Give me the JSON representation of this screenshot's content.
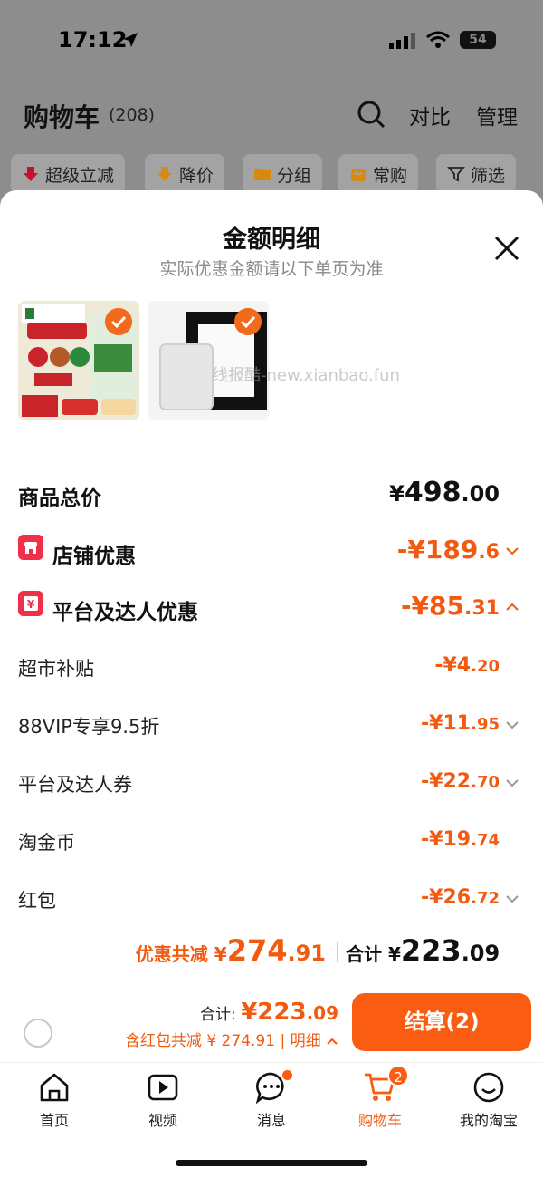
{
  "status": {
    "time": "17:12",
    "battery": "54"
  },
  "cart": {
    "title": "购物车",
    "count": "(208)",
    "compare": "对比",
    "manage": "管理",
    "chips": [
      "超级立减",
      "降价",
      "分组",
      "常购",
      "筛选"
    ]
  },
  "sheet": {
    "title": "金额明细",
    "subtitle": "实际优惠金额请以下单页为准",
    "watermark": "线报酷-new.xianbao.fun",
    "rows": {
      "total_label": "商品总价",
      "total_symbol": "¥",
      "total_int": "498",
      "total_dec": ".00",
      "shop_label": "店铺优惠",
      "shop_int": "-¥189",
      "shop_dec": ".6",
      "platform_label": "平台及达人优惠",
      "platform_int": "-¥85",
      "platform_dec": ".31",
      "sub1_label": "超市补贴",
      "sub1_int": "-¥4",
      "sub1_dec": ".20",
      "sub2_label": "88VIP专享9.5折",
      "sub2_int": "-¥11",
      "sub2_dec": ".95",
      "sub3_label": "平台及达人券",
      "sub3_int": "-¥22",
      "sub3_dec": ".70",
      "sub4_label": "淘金币",
      "sub4_int": "-¥19",
      "sub4_dec": ".74",
      "sub5_label": "红包",
      "sub5_int": "-¥26",
      "sub5_dec": ".72"
    },
    "summary": {
      "discount_label": "优惠共减 ¥",
      "discount_int": "274",
      "discount_dec": ".91",
      "total_label": "合计 ¥",
      "total_int": "223",
      "total_dec": ".09"
    }
  },
  "checkout": {
    "total_label": "合计:",
    "total_int": "¥223",
    "total_dec": ".09",
    "note": "含红包共减 ¥ 274.91 | 明细",
    "button": "结算(2)"
  },
  "tabbar": {
    "items": [
      "首页",
      "视频",
      "消息",
      "购物车",
      "我的淘宝"
    ],
    "cart_badge": "2"
  },
  "colors": {
    "accent": "#fa5c12",
    "discount_text": "#f25a10",
    "shop_icon": "#f0304a"
  }
}
